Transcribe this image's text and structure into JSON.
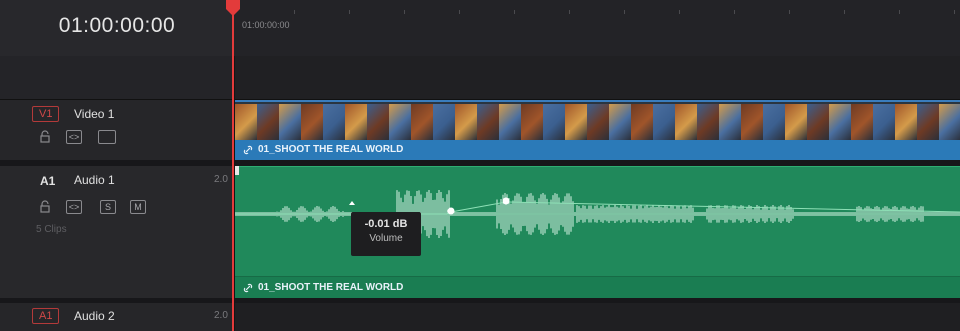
{
  "header": {
    "timecode": "01:00:00:00",
    "ruler_start": "01:00:00:00"
  },
  "tracks": {
    "video1": {
      "badge": "V1",
      "name": "Video 1"
    },
    "audio1": {
      "badge": "A1",
      "name": "Audio 1",
      "gain": "2.0",
      "clip_count": "5 Clips",
      "solo_label": "S",
      "mute_label": "M"
    },
    "audio2": {
      "badge": "A1",
      "name": "Audio 2",
      "gain": "2.0"
    }
  },
  "clips": {
    "video_clip_name": "01_SHOOT THE REAL WORLD",
    "audio_clip_name": "01_SHOOT THE REAL WORLD"
  },
  "tooltip": {
    "value": "-0.01 dB",
    "label": "Volume"
  },
  "colors": {
    "playhead": "#e33b3b",
    "video_clip": "#2b7ab8",
    "audio_clip": "#20895b",
    "badge_red": "#d04848"
  }
}
